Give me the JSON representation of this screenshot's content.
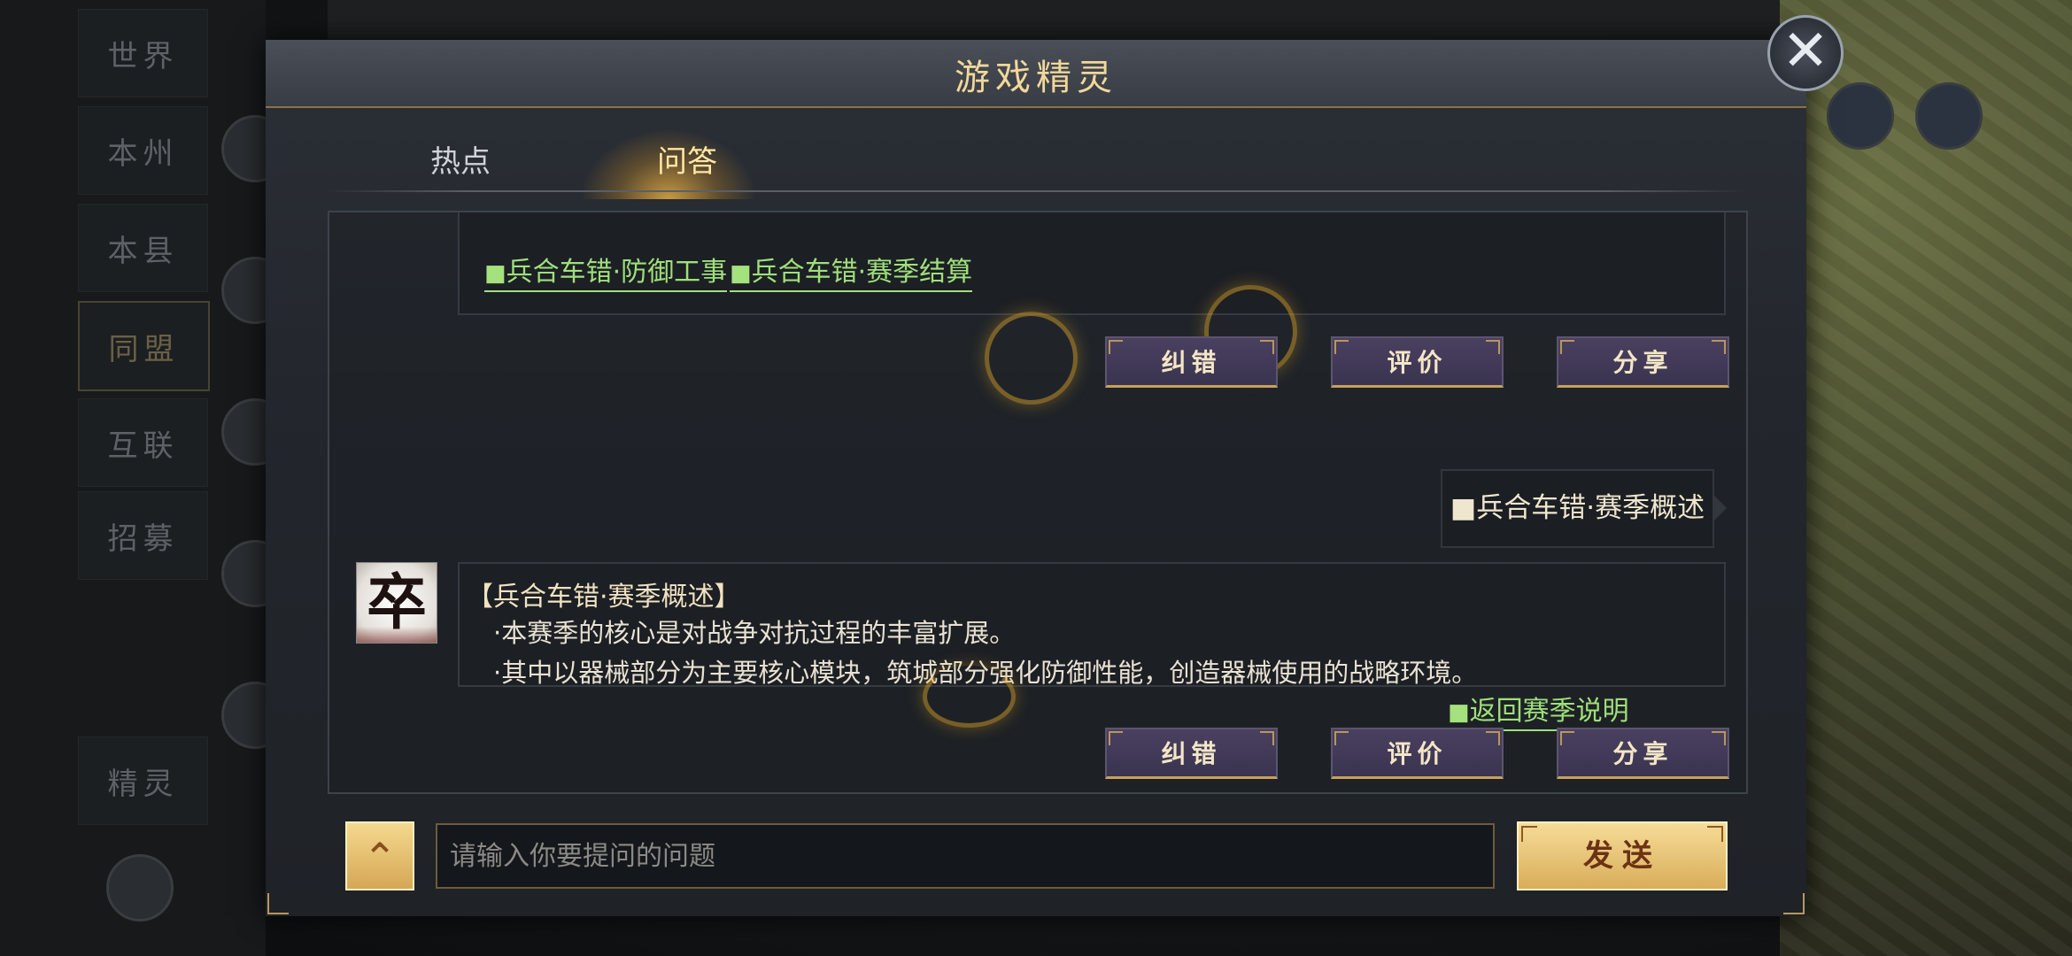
{
  "dialog": {
    "title": "游戏精灵",
    "close_icon": "crossed-swords-close-icon"
  },
  "tabs": [
    {
      "label": "热点",
      "active": false
    },
    {
      "label": "问答",
      "active": true
    }
  ],
  "chat": {
    "link_block": {
      "links": [
        {
          "label": "兵合车错·防御工事"
        },
        {
          "label": "兵合车错·赛季结算"
        }
      ]
    },
    "actions_1": {
      "correct": "纠错",
      "rate": "评价",
      "share": "分享"
    },
    "user_message": "■兵合车错·赛季概述",
    "answer": {
      "avatar_glyph": "卒",
      "title": "【兵合车错·赛季概述】",
      "lines": [
        "·本赛季的核心是对战争对抗过程的丰富扩展。",
        "·其中以器械部分为主要核心模块，筑城部分强化防御性能，创造器械使用的战略环境。"
      ],
      "return_link": "返回赛季说明"
    },
    "actions_2": {
      "correct": "纠错",
      "rate": "评价",
      "share": "分享"
    }
  },
  "input": {
    "placeholder": "请输入你要提问的问题",
    "value": "",
    "expand_icon": "chevron-up-icon",
    "send_label": "发送"
  },
  "background": {
    "sidebar_items": [
      "世界",
      "本州",
      "本县",
      "同盟",
      "互联",
      "招募",
      "精灵"
    ]
  }
}
